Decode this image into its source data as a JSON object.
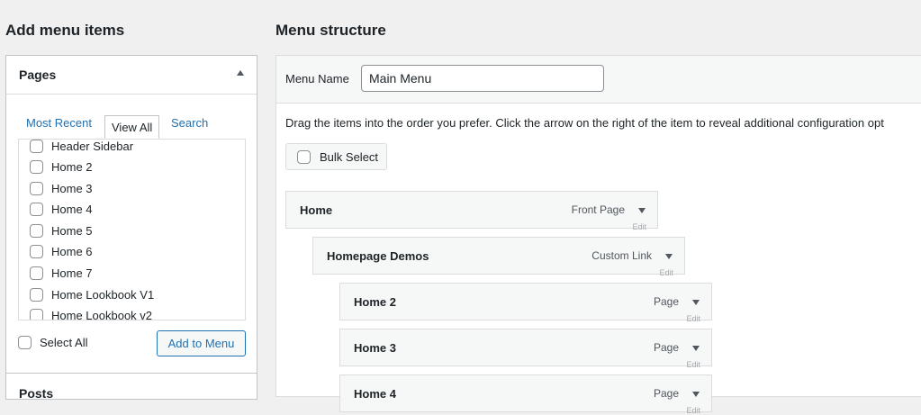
{
  "left": {
    "heading": "Add menu items",
    "pages_panel": {
      "title": "Pages",
      "tabs": [
        "Most Recent",
        "View All",
        "Search"
      ],
      "items": [
        "Header Sidebar",
        "Home 2",
        "Home 3",
        "Home 4",
        "Home 5",
        "Home 6",
        "Home 7",
        "Home Lookbook V1",
        "Home Lookbook v2"
      ],
      "select_all": "Select All",
      "add_button": "Add to Menu"
    },
    "next_panel_title": "Posts"
  },
  "right": {
    "heading": "Menu structure",
    "menu_name_label": "Menu Name",
    "menu_name_value": "Main Menu",
    "instructions": "Drag the items into the order you prefer. Click the arrow on the right of the item to reveal additional configuration opt",
    "bulk_select": "Bulk Select",
    "items": [
      {
        "title": "Home",
        "type": "Front Page",
        "edit": "Edit"
      },
      {
        "title": "Homepage Demos",
        "type": "Custom Link",
        "edit": "Edit"
      },
      {
        "title": "Home 2",
        "type": "Page",
        "edit": "Edit"
      },
      {
        "title": "Home 3",
        "type": "Page",
        "edit": "Edit"
      },
      {
        "title": "Home 4",
        "type": "Page",
        "edit": "Edit"
      }
    ]
  }
}
